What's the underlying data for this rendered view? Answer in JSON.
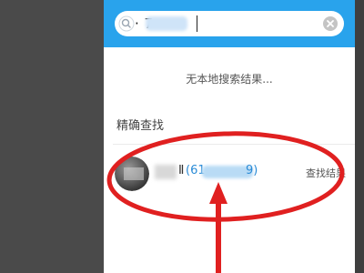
{
  "search": {
    "query_visible": "· 7",
    "clear_icon": "close-circle-icon",
    "search_icon": "search-icon"
  },
  "no_local_results": "无本地搜索结果...",
  "exact_search": {
    "title": "精确查找",
    "result": {
      "name_suffix": "Ⅱ",
      "id_open": "(61",
      "id_close": "9)",
      "action_label": "查找结果"
    }
  },
  "annotation": {
    "color": "#e02020"
  },
  "colors": {
    "header": "#29a3ec",
    "link": "#2a8bd6"
  }
}
